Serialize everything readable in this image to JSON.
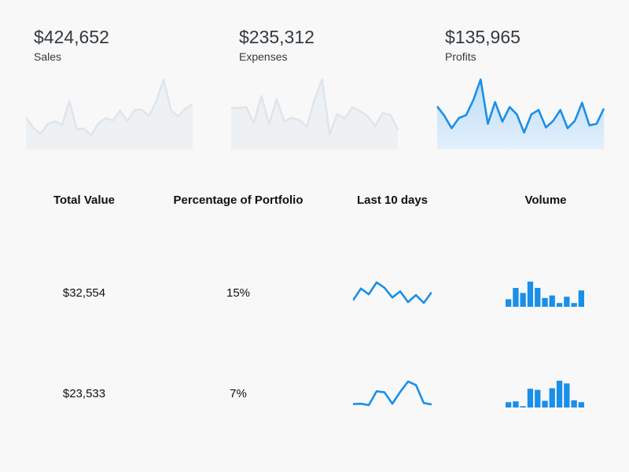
{
  "colors": {
    "accent": "#1a8fe8",
    "accent_fill_top": "#bcdcf7",
    "accent_fill_bottom": "#e3f0fc",
    "muted_line": "#dfe5ea",
    "muted_fill": "#eef1f4",
    "text": "#333a40"
  },
  "kpis": [
    {
      "amount": "$424,652",
      "label": "Sales",
      "active": false
    },
    {
      "amount": "$235,312",
      "label": "Expenses",
      "active": false
    },
    {
      "amount": "$135,965",
      "label": "Profits",
      "active": true
    }
  ],
  "table": {
    "headers": [
      "Total Value",
      "Percentage of Portfolio",
      "Last 10 days",
      "Volume"
    ],
    "rows": [
      {
        "total_value": "$32,554",
        "percentage": "15%"
      },
      {
        "total_value": "$23,533",
        "percentage": "7%"
      }
    ]
  },
  "chart_data": [
    {
      "type": "area",
      "title": "",
      "series": [
        {
          "values": [
            4.0,
            2.6,
            1.8,
            3.1,
            3.5,
            3.0,
            6.2,
            2.4,
            2.5,
            1.6,
            3.2,
            3.9,
            3.6,
            4.9,
            3.5,
            5.0,
            5.0,
            4.2,
            6.2,
            9.1,
            5.0,
            4.1,
            5.2,
            5.8
          ]
        }
      ],
      "grid": false
    },
    {
      "type": "area",
      "title": "",
      "series": [
        {
          "values": [
            5.2,
            5.2,
            5.3,
            3.2,
            6.8,
            3.0,
            6.4,
            3.4,
            3.9,
            3.6,
            2.7,
            6.3,
            9.0,
            1.7,
            4.4,
            3.8,
            5.3,
            4.8,
            4.1,
            2.8,
            4.5,
            4.3,
            2.3
          ]
        }
      ],
      "grid": false
    },
    {
      "type": "area",
      "title": "",
      "series": [
        {
          "values": [
            5.6,
            4.3,
            2.6,
            4.0,
            4.4,
            6.5,
            9.3,
            3.2,
            6.2,
            3.5,
            5.5,
            4.5,
            2.0,
            4.5,
            5.1,
            2.7,
            3.6,
            5.1,
            2.6,
            3.6,
            6.1,
            3.0,
            3.2,
            5.3
          ]
        }
      ],
      "grid": false
    },
    {
      "type": "line",
      "title": "",
      "series": [
        {
          "values": [
            1.5,
            4.4,
            3.0,
            5.9,
            4.6,
            2.2,
            3.7,
            1.1,
            2.8,
            0.9,
            3.5
          ]
        }
      ],
      "grid": false
    },
    {
      "type": "bar",
      "title": "",
      "series": [
        {
          "values": [
            3,
            7.5,
            5.5,
            10,
            7.5,
            3.5,
            4.5,
            1.5,
            4,
            1.5,
            6.5
          ]
        }
      ],
      "grid": false
    },
    {
      "type": "line",
      "title": "",
      "series": [
        {
          "values": [
            0.5,
            0.6,
            0.2,
            4.2,
            3.9,
            0.6,
            4.0,
            7.0,
            6.0,
            0.8,
            0.4
          ]
        }
      ],
      "grid": false
    },
    {
      "type": "bar",
      "title": "",
      "series": [
        {
          "values": [
            2,
            2.3,
            0.5,
            7,
            6.6,
            2.5,
            7.2,
            10,
            9,
            2.7,
            2
          ]
        }
      ],
      "grid": false
    }
  ]
}
